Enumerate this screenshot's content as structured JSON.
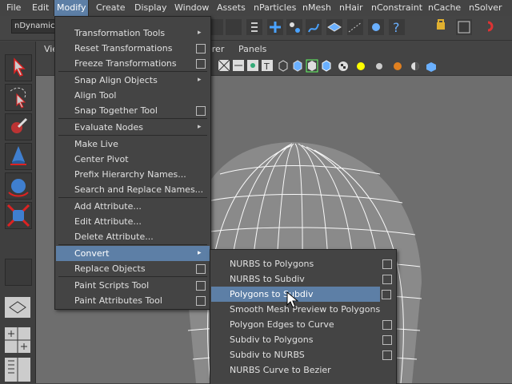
{
  "menubar": {
    "items": [
      "File",
      "Edit",
      "Modify",
      "Create",
      "Display",
      "Window",
      "Assets",
      "nParticles",
      "nMesh",
      "nHair",
      "nConstraint",
      "nCache",
      "nSolver"
    ]
  },
  "shelf": {
    "menu_set": "nDynamics"
  },
  "panel": {
    "view_label": "Vie",
    "renderer_label": "erer",
    "panels_label": "Panels"
  },
  "modify_menu": {
    "items": [
      {
        "label": "Transformation Tools",
        "submenu": true,
        "option": false
      },
      {
        "label": "Reset Transformations",
        "submenu": false,
        "option": true
      },
      {
        "label": "Freeze Transformations",
        "submenu": false,
        "option": true
      },
      {
        "label": "Snap Align Objects",
        "submenu": true,
        "option": false
      },
      {
        "label": "Align Tool",
        "submenu": false,
        "option": false
      },
      {
        "label": "Snap Together Tool",
        "submenu": false,
        "option": true
      },
      {
        "label": "Evaluate Nodes",
        "submenu": true,
        "option": false
      },
      {
        "label": "Make Live",
        "submenu": false,
        "option": false
      },
      {
        "label": "Center Pivot",
        "submenu": false,
        "option": false
      },
      {
        "label": "Prefix Hierarchy Names...",
        "submenu": false,
        "option": false
      },
      {
        "label": "Search and Replace Names...",
        "submenu": false,
        "option": false
      },
      {
        "label": "Add Attribute...",
        "submenu": false,
        "option": false
      },
      {
        "label": "Edit Attribute...",
        "submenu": false,
        "option": false
      },
      {
        "label": "Delete Attribute...",
        "submenu": false,
        "option": false
      },
      {
        "label": "Convert",
        "submenu": true,
        "option": false,
        "highlighted": true
      },
      {
        "label": "Replace Objects",
        "submenu": false,
        "option": true
      },
      {
        "label": "Paint Scripts Tool",
        "submenu": false,
        "option": true
      },
      {
        "label": "Paint Attributes Tool",
        "submenu": false,
        "option": true
      }
    ]
  },
  "convert_menu": {
    "items": [
      {
        "label": "NURBS to Polygons",
        "option": true
      },
      {
        "label": "NURBS to Subdiv",
        "option": true
      },
      {
        "label": "Polygons to Subdiv",
        "option": true,
        "highlighted": true
      },
      {
        "label": "Smooth Mesh Preview to Polygons",
        "option": false
      },
      {
        "label": "Polygon Edges to Curve",
        "option": true
      },
      {
        "label": "Subdiv to Polygons",
        "option": true
      },
      {
        "label": "Subdiv to NURBS",
        "option": true
      },
      {
        "label": "NURBS Curve to Bezier",
        "option": false
      }
    ]
  },
  "colors": {
    "accent": "#5d7fa6",
    "menu_bg": "#444444",
    "viewport_bg": "#6e6e6e"
  }
}
